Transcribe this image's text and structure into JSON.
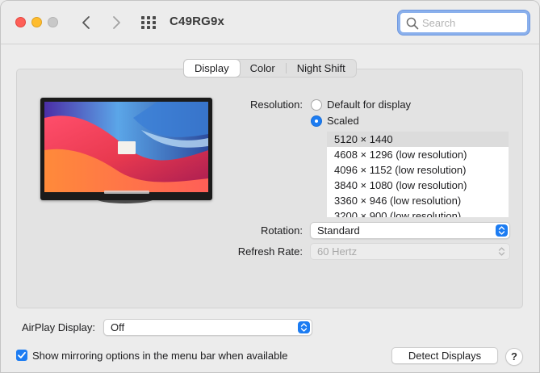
{
  "window": {
    "title": "C49RG9x",
    "search_placeholder": "Search"
  },
  "tabs": [
    {
      "label": "Display",
      "active": true
    },
    {
      "label": "Color",
      "active": false
    },
    {
      "label": "Night Shift",
      "active": false
    }
  ],
  "resolution": {
    "label": "Resolution:",
    "options": [
      {
        "label": "Default for display",
        "selected": false
      },
      {
        "label": "Scaled",
        "selected": true
      }
    ],
    "scaled_list": [
      "5120 × 1440",
      "4608 × 1296 (low resolution)",
      "4096 × 1152 (low resolution)",
      "3840 × 1080 (low resolution)",
      "3360 × 946 (low resolution)",
      "3200 × 900 (low resolution)"
    ],
    "selected_scaled": "5120 × 1440"
  },
  "rotation": {
    "label": "Rotation:",
    "value": "Standard"
  },
  "refresh_rate": {
    "label": "Refresh Rate:",
    "value": "60 Hertz",
    "enabled": false
  },
  "airplay": {
    "label": "AirPlay Display:",
    "value": "Off"
  },
  "mirroring": {
    "label": "Show mirroring options in the menu bar when available",
    "checked": true
  },
  "buttons": {
    "detect": "Detect Displays",
    "help": "?"
  },
  "colors": {
    "accent": "#1c7cf2",
    "close": "#fe5f57",
    "minimize": "#febc2e",
    "zoom_disabled": "#c8c8c8"
  }
}
